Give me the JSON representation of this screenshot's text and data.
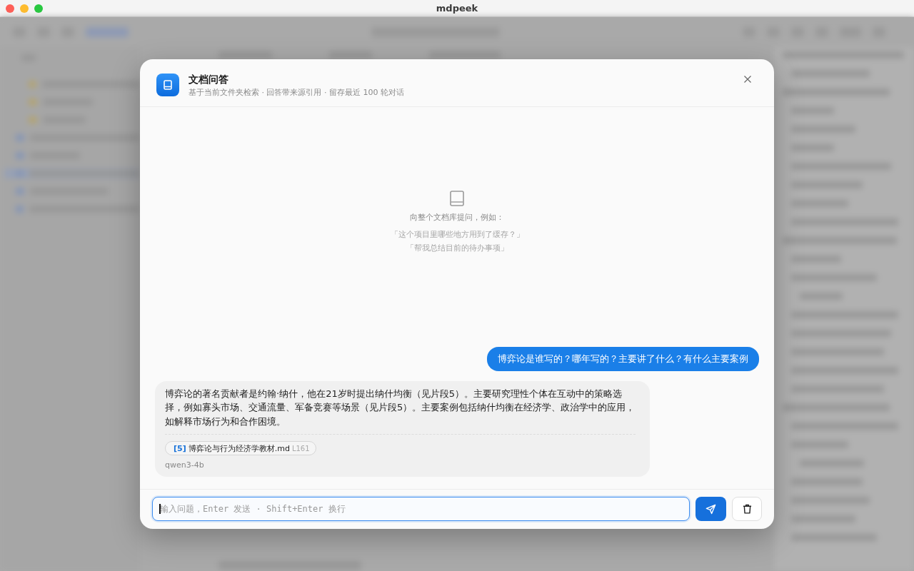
{
  "window": {
    "title": "mdpeek"
  },
  "dialog": {
    "title": "文档问答",
    "subtitle": "基于当前文件夹检索 · 回答带来源引用 · 留存最近 100 轮对话"
  },
  "empty_state": {
    "prompt": "向整个文档库提问，例如：",
    "examples": [
      "「这个项目里哪些地方用到了缓存？」",
      "「帮我总结目前的待办事项」"
    ]
  },
  "messages": [
    {
      "kind": "user",
      "text": "博弈论是谁写的？哪年写的？主要讲了什么？有什么主要案例"
    },
    {
      "kind": "assistant",
      "text": "博弈论的著名贡献者是约翰·纳什，他在21岁时提出纳什均衡（见片段5）。主要研究理性个体在互动中的策略选择，例如寡头市场、交通流量、军备竞赛等场景（见片段5）。主要案例包括纳什均衡在经济学、政治学中的应用，如解释市场行为和合作困境。",
      "citations": [
        {
          "index": "[5]",
          "file": "博弈论与行为经济学教材.md",
          "line": "L161"
        }
      ],
      "model": "qwen3-4b"
    }
  ],
  "composer": {
    "placeholder": "输入问题，Enter 发送 · Shift+Enter 换行",
    "focused": true
  }
}
